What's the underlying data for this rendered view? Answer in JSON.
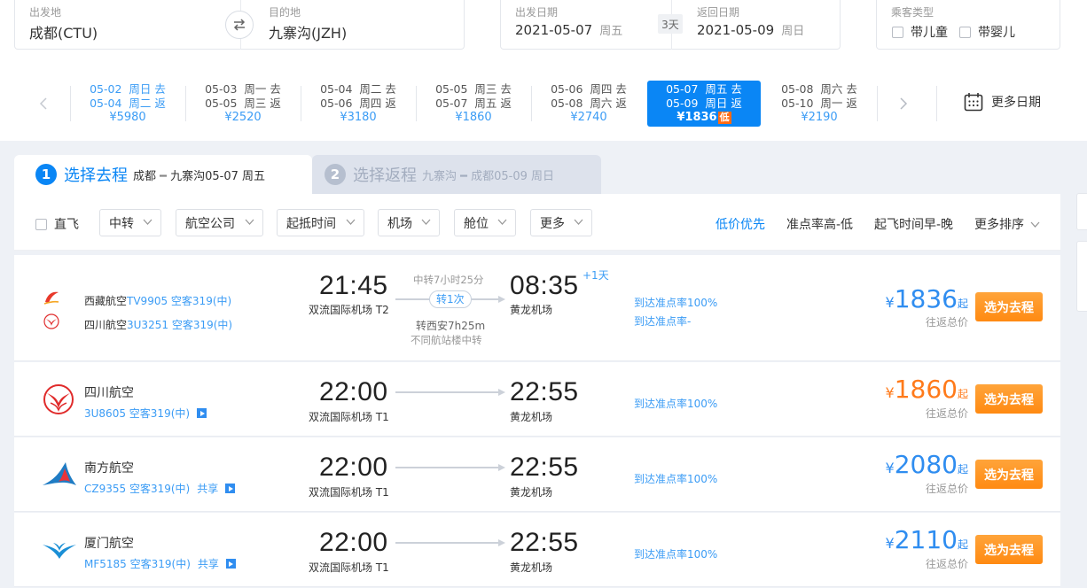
{
  "search": {
    "from_label": "出发地",
    "from_value": "成都(CTU)",
    "to_label": "目的地",
    "to_value": "九寨沟(JZH)",
    "depart_label": "出发日期",
    "depart_date": "2021-05-07",
    "depart_weekday": "周五",
    "days_badge": "3天",
    "return_label": "返回日期",
    "return_date": "2021-05-09",
    "return_weekday": "周日",
    "passenger_label": "乘客类型",
    "child_label": "带儿童",
    "infant_label": "带婴儿"
  },
  "date_strip": [
    {
      "go_date": "05-02",
      "go_wk": "周日",
      "go_tag": "去",
      "back_date": "05-04",
      "back_wk": "周二",
      "back_tag": "返",
      "price": "¥5980"
    },
    {
      "go_date": "05-03",
      "go_wk": "周一",
      "go_tag": "去",
      "back_date": "05-05",
      "back_wk": "周三",
      "back_tag": "返",
      "price": "¥2520"
    },
    {
      "go_date": "05-04",
      "go_wk": "周二",
      "go_tag": "去",
      "back_date": "05-06",
      "back_wk": "周四",
      "back_tag": "返",
      "price": "¥3180"
    },
    {
      "go_date": "05-05",
      "go_wk": "周三",
      "go_tag": "去",
      "back_date": "05-07",
      "back_wk": "周五",
      "back_tag": "返",
      "price": "¥1860"
    },
    {
      "go_date": "05-06",
      "go_wk": "周四",
      "go_tag": "去",
      "back_date": "05-08",
      "back_wk": "周六",
      "back_tag": "返",
      "price": "¥2740"
    },
    {
      "go_date": "05-07",
      "go_wk": "周五",
      "go_tag": "去",
      "back_date": "05-09",
      "back_wk": "周日",
      "back_tag": "返",
      "price": "¥1836",
      "low_tag": "低"
    },
    {
      "go_date": "05-08",
      "go_wk": "周六",
      "go_tag": "去",
      "back_date": "05-10",
      "back_wk": "周一",
      "back_tag": "返",
      "price": "¥2190"
    }
  ],
  "more_dates_label": "更多日期",
  "tabs": {
    "outbound_num": "1",
    "outbound_title": "选择去程",
    "outbound_route_from": "成都",
    "outbound_route_to": "九寨沟05-07 周五",
    "return_num": "2",
    "return_title": "选择返程",
    "return_route_from": "九寨沟",
    "return_route_to": "成都05-09 周日"
  },
  "filters": {
    "direct_label": "直飞",
    "buttons": [
      "中转",
      "航空公司",
      "起抵时间",
      "机场",
      "舱位",
      "更多"
    ],
    "sorts": [
      "低价优先",
      "准点率高-低",
      "起飞时间早-晚",
      "更多排序"
    ]
  },
  "flights": [
    {
      "airline1": "西藏航空",
      "flight1": "TV9905",
      "plane1": "空客319(中)",
      "airline2": "四川航空",
      "flight2": "3U3251",
      "plane2": "空客319(中)",
      "dep_time": "21:45",
      "dep_airport": "双流国际机场 T2",
      "arr_time": "08:35",
      "arr_airport": "黄龙机场",
      "plus_day": "+1天",
      "transfer_time": "中转7小时25分",
      "transfer_count": "转1次",
      "stop_city": "转西安7h25m",
      "stop_note": "不同航站楼中转",
      "ontime1": "到达准点率100%",
      "ontime2": "到达准点率-",
      "price_yen": "¥",
      "price": "1836",
      "price_suffix": "起",
      "price_sub": "往返总价",
      "book_label": "选为去程",
      "price_color": "#2f8df0"
    },
    {
      "airline": "四川航空",
      "flight": "3U8605",
      "plane": "空客319(中)",
      "dep_time": "22:00",
      "dep_airport": "双流国际机场 T1",
      "arr_time": "22:55",
      "arr_airport": "黄龙机场",
      "ontime": "到达准点率100%",
      "price_yen": "¥",
      "price": "1860",
      "price_suffix": "起",
      "price_sub": "往返总价",
      "book_label": "选为去程",
      "price_color": "#ff7a1a"
    },
    {
      "airline": "南方航空",
      "flight": "CZ9355",
      "plane": "空客319(中)",
      "share": "共享",
      "dep_time": "22:00",
      "dep_airport": "双流国际机场 T1",
      "arr_time": "22:55",
      "arr_airport": "黄龙机场",
      "ontime": "到达准点率100%",
      "price_yen": "¥",
      "price": "2080",
      "price_suffix": "起",
      "price_sub": "往返总价",
      "book_label": "选为去程",
      "price_color": "#2f8df0"
    },
    {
      "airline": "厦门航空",
      "flight": "MF5185",
      "plane": "空客319(中)",
      "share": "共享",
      "dep_time": "22:00",
      "dep_airport": "双流国际机场 T1",
      "arr_time": "22:55",
      "arr_airport": "黄龙机场",
      "ontime": "到达准点率100%",
      "price_yen": "¥",
      "price": "2110",
      "price_suffix": "起",
      "price_sub": "往返总价",
      "book_label": "选为去程",
      "price_color": "#2f8df0"
    }
  ],
  "colors": {
    "accent": "#0a86f5",
    "book_button": "#ff8a12",
    "low_tag": "#ff6a13"
  }
}
